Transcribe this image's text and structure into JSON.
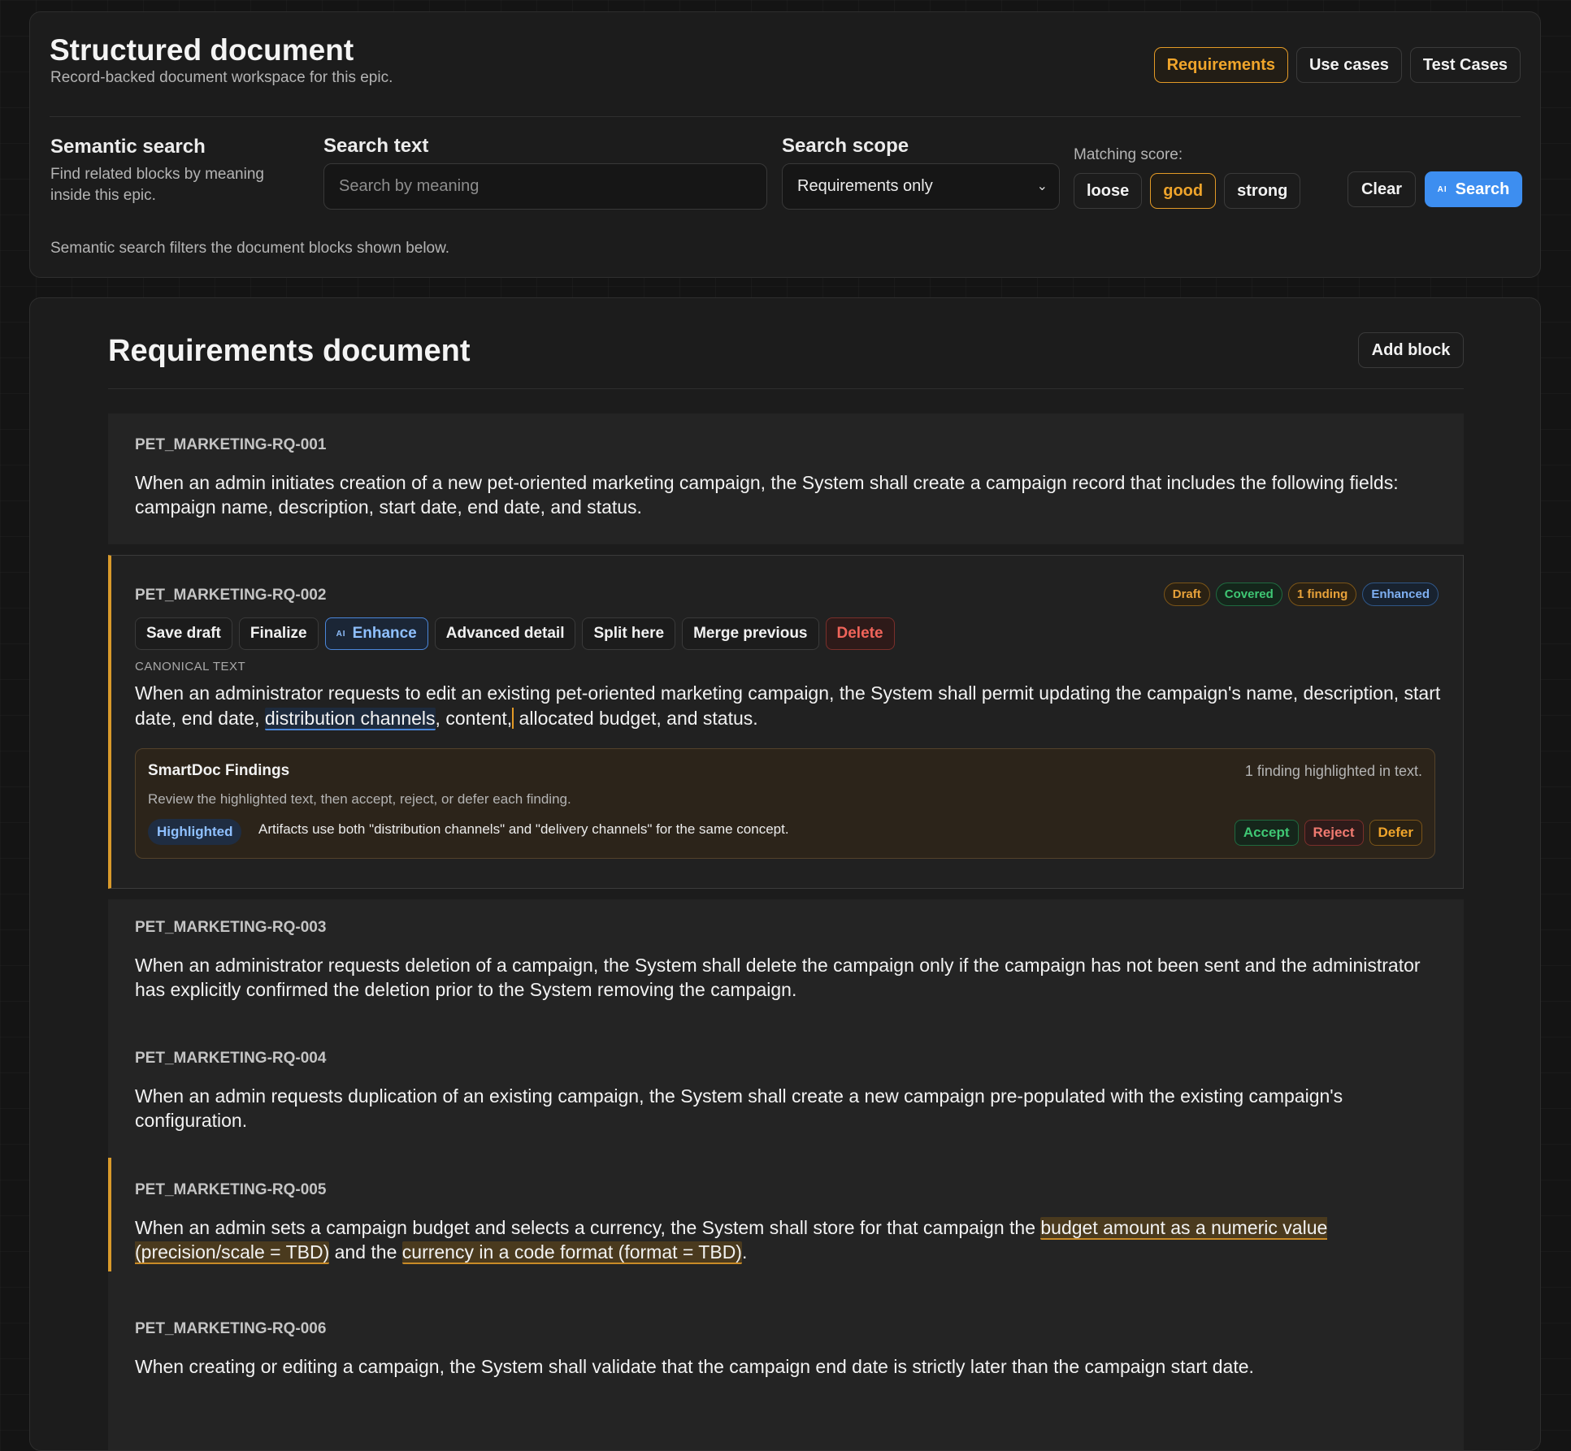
{
  "header": {
    "title": "Structured document",
    "subtitle": "Record-backed document workspace for this epic.",
    "tabs": [
      {
        "label": "Requirements",
        "active": true
      },
      {
        "label": "Use cases",
        "active": false
      },
      {
        "label": "Test Cases",
        "active": false
      }
    ]
  },
  "search": {
    "section_title": "Semantic search",
    "section_desc": "Find related blocks by meaning inside this epic.",
    "text_label": "Search text",
    "placeholder": "Search by meaning",
    "value": "",
    "scope_label": "Search scope",
    "scope_value": "Requirements only",
    "score_label": "Matching score:",
    "score_options": [
      "loose",
      "good",
      "strong"
    ],
    "score_selected": "good",
    "clear_label": "Clear",
    "search_label": "Search",
    "ai_mark": "AI",
    "note": "Semantic search filters the document blocks shown below."
  },
  "document": {
    "title": "Requirements document",
    "add_block_label": "Add block",
    "blocks": [
      {
        "id": "PET_MARKETING-RQ-001",
        "text": "When an admin initiates creation of a new pet-oriented marketing campaign, the System shall create a campaign record that includes the following fields: campaign name, description, start date, end date, and status."
      },
      {
        "id": "PET_MARKETING-RQ-002",
        "badges": [
          "Draft",
          "Covered",
          "1 finding",
          "Enhanced"
        ],
        "actions": [
          "Save draft",
          "Finalize",
          "Enhance",
          "Advanced detail",
          "Split here",
          "Merge previous",
          "Delete"
        ],
        "canonical_label": "CANONICAL TEXT",
        "text_before": "When an administrator requests to edit an existing pet-oriented marketing campaign, the System shall permit updating the campaign's name, description, start date, end date, ",
        "text_highlight": "distribution channels",
        "text_middle": ", content,",
        "text_after": " allocated budget, and status.",
        "findings": {
          "title": "SmartDoc Findings",
          "summary": "1 finding highlighted in text.",
          "description": "Review the highlighted text, then accept, reject, or defer each finding.",
          "chip": "Highlighted",
          "finding_text": "Artifacts use both \"distribution channels\" and \"delivery channels\" for the same concept.",
          "accept": "Accept",
          "reject": "Reject",
          "defer": "Defer"
        }
      },
      {
        "id": "PET_MARKETING-RQ-003",
        "text": "When an administrator requests deletion of a campaign, the System shall delete the campaign only if the campaign has not been sent and the administrator has explicitly confirmed the deletion prior to the System removing the campaign."
      },
      {
        "id": "PET_MARKETING-RQ-004",
        "text": "When an admin requests duplication of an existing campaign, the System shall create a new campaign pre-populated with the existing campaign's configuration."
      },
      {
        "id": "PET_MARKETING-RQ-005",
        "text_before": "When an admin sets a campaign budget and selects a currency, the System shall store for that campaign the ",
        "highlight_1": "budget amount as a numeric value (precision/scale = TBD)",
        "text_middle": " and the ",
        "highlight_2": "currency in a code format (format = TBD)",
        "text_after": "."
      },
      {
        "id": "PET_MARKETING-RQ-006",
        "text": "When creating or editing a campaign, the System shall validate that the campaign end date is strictly later than the campaign start date."
      }
    ]
  }
}
